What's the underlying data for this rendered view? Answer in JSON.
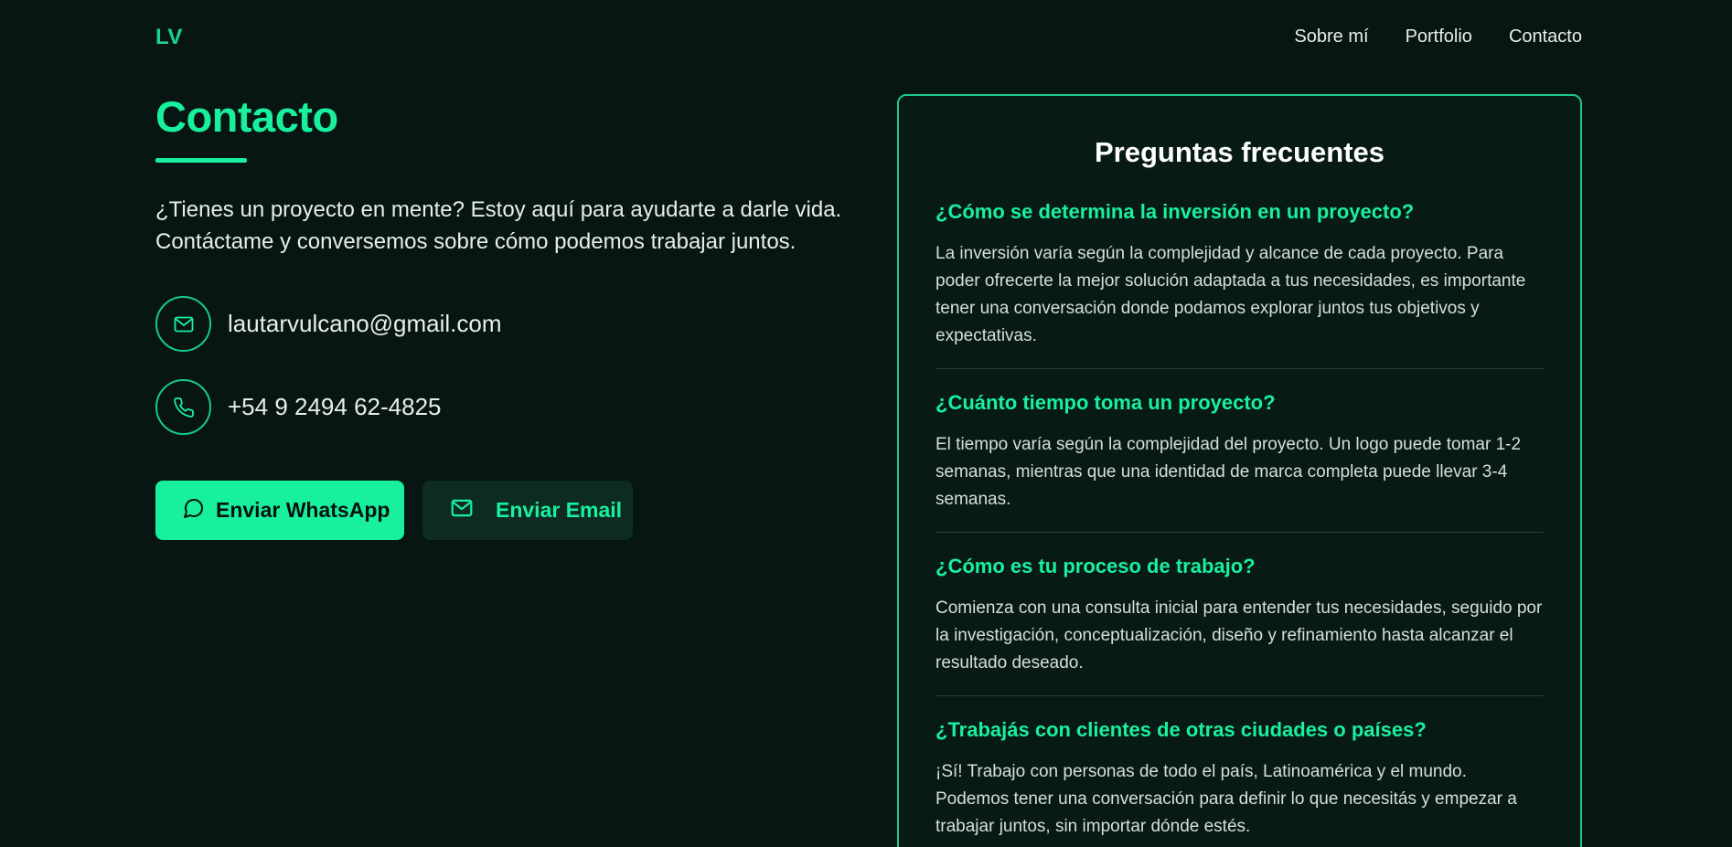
{
  "nav": {
    "logo": "LV",
    "links": [
      "Sobre mí",
      "Portfolio",
      "Contacto"
    ]
  },
  "contact": {
    "title": "Contacto",
    "intro": "¿Tienes un proyecto en mente? Estoy aquí para ayudarte a darle vida. Contáctame y conversemos sobre cómo podemos trabajar juntos.",
    "email": "lautarvulcano@gmail.com",
    "phone": "+54 9 2494 62-4825",
    "whatsapp_button": "Enviar WhatsApp",
    "email_button": "Enviar Email",
    "email_icon": "mail-icon",
    "phone_icon": "phone-icon",
    "whatsapp_icon": "chat-bubble-icon"
  },
  "faq": {
    "title": "Preguntas frecuentes",
    "items": [
      {
        "question": "¿Cómo se determina la inversión en un proyecto?",
        "answer": "La inversión varía según la complejidad y alcance de cada proyecto. Para poder ofrecerte la mejor solución adaptada a tus necesidades, es importante tener una conversación donde podamos explorar juntos tus objetivos y expectativas."
      },
      {
        "question": "¿Cuánto tiempo toma un proyecto?",
        "answer": "El tiempo varía según la complejidad del proyecto. Un logo puede tomar 1-2 semanas, mientras que una identidad de marca completa puede llevar 3-4 semanas."
      },
      {
        "question": "¿Cómo es tu proceso de trabajo?",
        "answer": "Comienza con una consulta inicial para entender tus necesidades, seguido por la investigación, conceptualización, diseño y refinamiento hasta alcanzar el resultado deseado."
      },
      {
        "question": "¿Trabajás con clientes de otras ciudades o países?",
        "answer": "¡Sí! Trabajo con personas de todo el país, Latinoamérica y el mundo. Podemos tener una conversación para definir lo que necesitás y empezar a trabajar juntos, sin importar dónde estés."
      }
    ]
  },
  "colors": {
    "background": "#071612",
    "accent": "#19f09e",
    "text": "#e8ede9"
  }
}
